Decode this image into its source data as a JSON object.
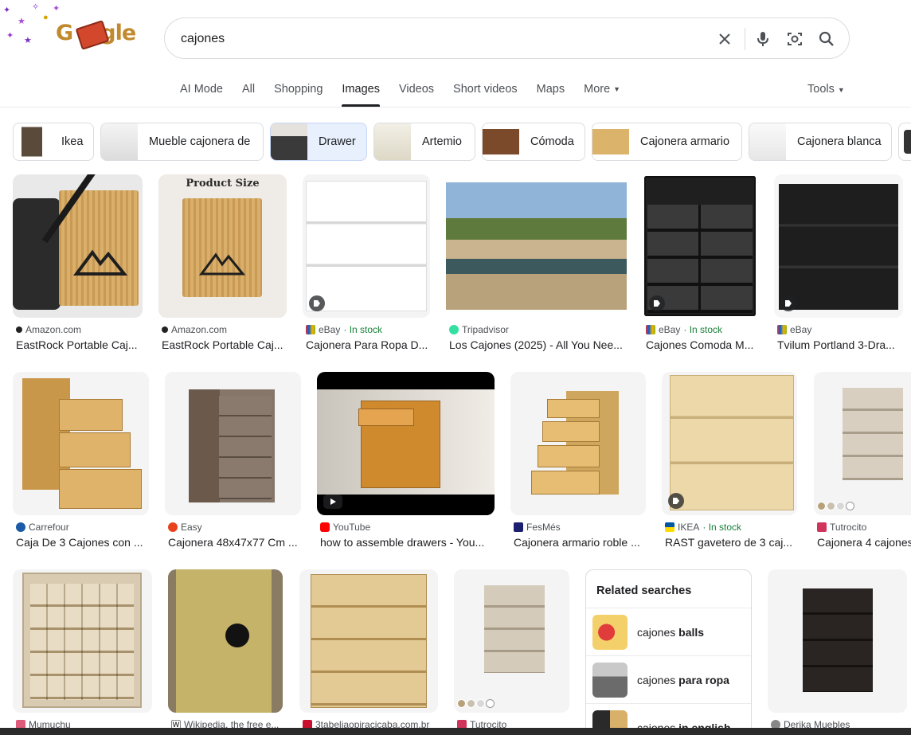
{
  "logo": {
    "text": "Google"
  },
  "search": {
    "query": "cajones"
  },
  "tabs": [
    {
      "label": "AI Mode"
    },
    {
      "label": "All"
    },
    {
      "label": "Shopping"
    },
    {
      "label": "Images",
      "active": true
    },
    {
      "label": "Videos"
    },
    {
      "label": "Short videos"
    },
    {
      "label": "Maps"
    },
    {
      "label": "More"
    }
  ],
  "tools_label": "Tools",
  "chips": [
    {
      "label": "Ikea"
    },
    {
      "label": "Mueble cajonera de"
    },
    {
      "label": "Drawer",
      "active": true
    },
    {
      "label": "Artemio"
    },
    {
      "label": "Cómoda"
    },
    {
      "label": "Cajonera armario"
    },
    {
      "label": "Cajonera blanca"
    }
  ],
  "results_row1": [
    {
      "source": "Amazon.com",
      "stock": "",
      "title": "EastRock Portable Caj..."
    },
    {
      "source": "Amazon.com",
      "stock": "",
      "title": "EastRock Portable Caj..."
    },
    {
      "source": "eBay",
      "stock": " · In stock",
      "title": "Cajonera Para Ropa D..."
    },
    {
      "source": "Tripadvisor",
      "stock": "",
      "title": "Los Cajones (2025) - All You Nee..."
    },
    {
      "source": "eBay",
      "stock": " · In stock",
      "title": "Cajones Comoda M..."
    },
    {
      "source": "eBay",
      "stock": "",
      "title": "Tvilum Portland 3-Dra..."
    }
  ],
  "product_size_label": "Product Size",
  "results_row2": [
    {
      "source": "Carrefour",
      "stock": "",
      "title": "Caja De 3 Cajones con ..."
    },
    {
      "source": "Easy",
      "stock": "",
      "title": "Cajonera 48x47x77 Cm ..."
    },
    {
      "source": "YouTube",
      "stock": "",
      "title": "how to assemble drawers - You..."
    },
    {
      "source": "FesMés",
      "stock": "",
      "title": "Cajonera armario roble ..."
    },
    {
      "source": "IKEA",
      "stock": " · In stock",
      "title": "RAST gavetero de 3 caj..."
    },
    {
      "source": "Tutrocito",
      "stock": "",
      "title": "Cajonera 4 cajones"
    }
  ],
  "results_row3": [
    {
      "source": "Mumuchu"
    },
    {
      "source": "Wikipedia, the free e..."
    },
    {
      "source": "3tabeliaopiracicaba.com.br"
    },
    {
      "source": "Tutrocito"
    },
    {
      "source": "Derika Muebles"
    }
  ],
  "related": {
    "header": "Related searches",
    "items": [
      {
        "prefix": "cajones ",
        "bold": "balls"
      },
      {
        "prefix": "cajones ",
        "bold": "para ropa"
      },
      {
        "prefix": "cajones ",
        "bold": "in english"
      }
    ]
  },
  "colors": {
    "wood": "#d9a95a",
    "dark": "#2a2a2a",
    "accent_stock": "#188038"
  }
}
